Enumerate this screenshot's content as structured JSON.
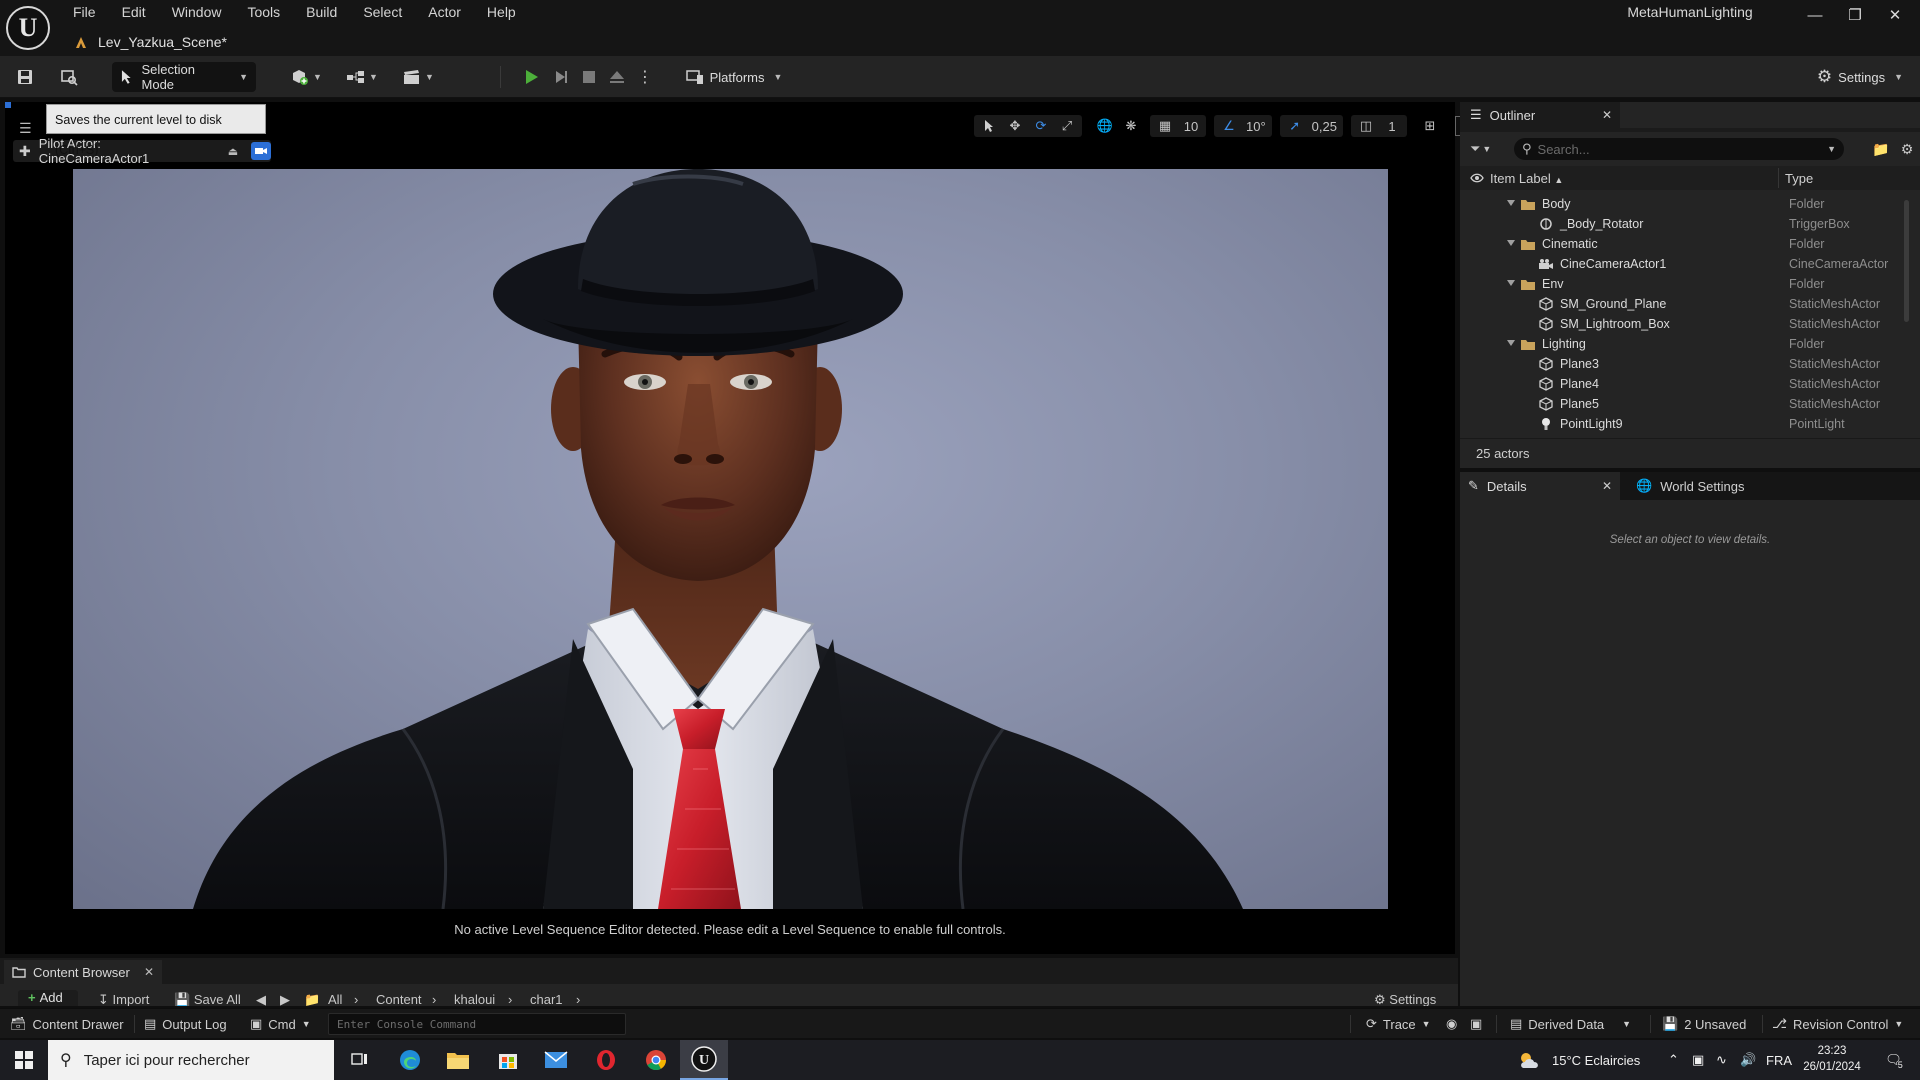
{
  "menu": [
    "File",
    "Edit",
    "Window",
    "Tools",
    "Build",
    "Select",
    "Actor",
    "Help"
  ],
  "app_title": "MetaHumanLighting",
  "level_tab": "Lev_Yazkua_Scene*",
  "toolbar": {
    "selection_mode": "Selection Mode",
    "platforms": "Platforms",
    "settings": "Settings",
    "tooltip": "Saves the current level to disk (Ctrl+S)"
  },
  "viewport": {
    "pilot_actor": "Pilot Actor: CineCameraActor1",
    "grid_snap": "10",
    "rotation_snap": "10°",
    "scale_snap": "0,25",
    "camera_speed": "1",
    "no_sequence_msg": "No active Level Sequence Editor detected. Please edit a Level Sequence to enable full controls."
  },
  "content_browser": {
    "tab": "Content Browser",
    "add": "Add",
    "import": "Import",
    "save_all": "Save All",
    "path": [
      "All",
      "Content",
      "khaloui",
      "char1"
    ],
    "settings": "Settings"
  },
  "statusbar": {
    "content_drawer": "Content Drawer",
    "output_log": "Output Log",
    "cmd": "Cmd",
    "console_placeholder": "Enter Console Command",
    "trace": "Trace",
    "derived_data": "Derived Data",
    "unsaved": "2 Unsaved",
    "revision_control": "Revision Control"
  },
  "outliner": {
    "tab": "Outliner",
    "search_placeholder": "Search...",
    "col_label": "Item Label",
    "col_type": "Type",
    "rows": [
      {
        "name": "Body",
        "type": "Folder"
      },
      {
        "name": "_Body_Rotator",
        "type": "TriggerBox"
      },
      {
        "name": "Cinematic",
        "type": "Folder"
      },
      {
        "name": "CineCameraActor1",
        "type": "CineCameraActor"
      },
      {
        "name": "Env",
        "type": "Folder"
      },
      {
        "name": "SM_Ground_Plane",
        "type": "StaticMeshActor"
      },
      {
        "name": "SM_Lightroom_Box",
        "type": "StaticMeshActor"
      },
      {
        "name": "Lighting",
        "type": "Folder"
      },
      {
        "name": "Plane3",
        "type": "StaticMeshActor"
      },
      {
        "name": "Plane4",
        "type": "StaticMeshActor"
      },
      {
        "name": "Plane5",
        "type": "StaticMeshActor"
      },
      {
        "name": "PointLight9",
        "type": "PointLight"
      }
    ],
    "actor_count": "25 actors"
  },
  "details": {
    "tab": "Details",
    "world_tab": "World Settings",
    "empty_msg": "Select an object to view details."
  },
  "taskbar": {
    "search_placeholder": "Taper ici pour rechercher",
    "weather": "15°C  Eclaircies",
    "lang": "FRA",
    "time": "23:23",
    "date": "26/01/2024",
    "notifications": "5"
  },
  "colors": {
    "accent_blue": "#2c6fd6",
    "play_green": "#4caf3a",
    "folder": "#c9a35c",
    "tie_red": "#c81e2a"
  }
}
